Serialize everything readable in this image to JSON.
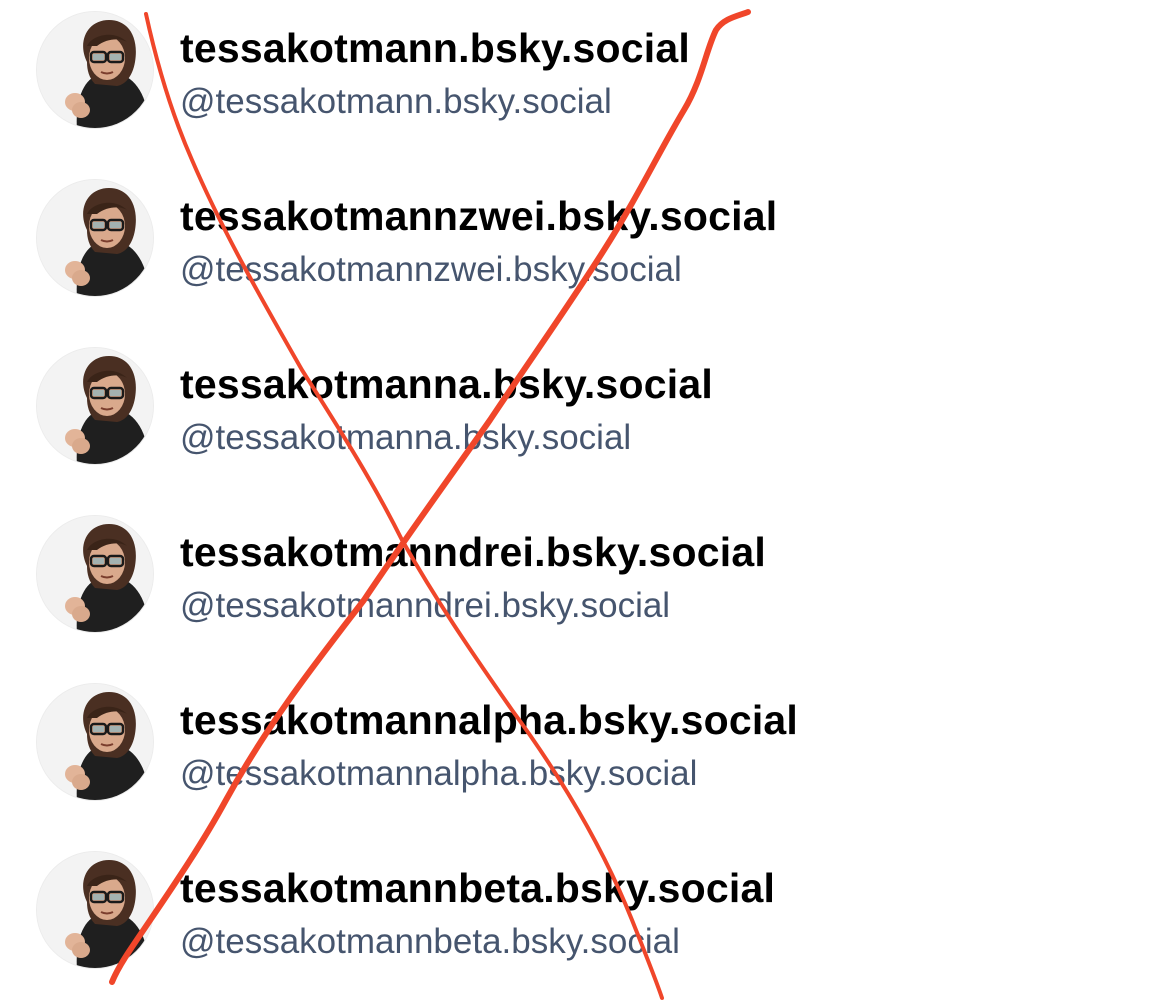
{
  "accounts": [
    {
      "display_name": "tessakotmann.bsky.social",
      "handle": "@tessakotmann.bsky.social"
    },
    {
      "display_name": "tessakotmannzwei.bsky.social",
      "handle": "@tessakotmannzwei.bsky.social"
    },
    {
      "display_name": "tessakotmanna.bsky.social",
      "handle": "@tessakotmanna.bsky.social"
    },
    {
      "display_name": "tessakotmanndrei.bsky.social",
      "handle": "@tessakotmanndrei.bsky.social"
    },
    {
      "display_name": "tessakotmannalpha.bsky.social",
      "handle": "@tessakotmannalpha.bsky.social"
    },
    {
      "display_name": "tessakotmannbeta.bsky.social",
      "handle": "@tessakotmannbeta.bsky.social"
    }
  ],
  "colors": {
    "display_name": "#000000",
    "handle": "#46556e",
    "cross_out_mark": "#f0462a"
  },
  "overlay": {
    "type": "hand-drawn red X",
    "icon": "cross-out-mark"
  },
  "avatar_icon": "person-avatar-icon"
}
